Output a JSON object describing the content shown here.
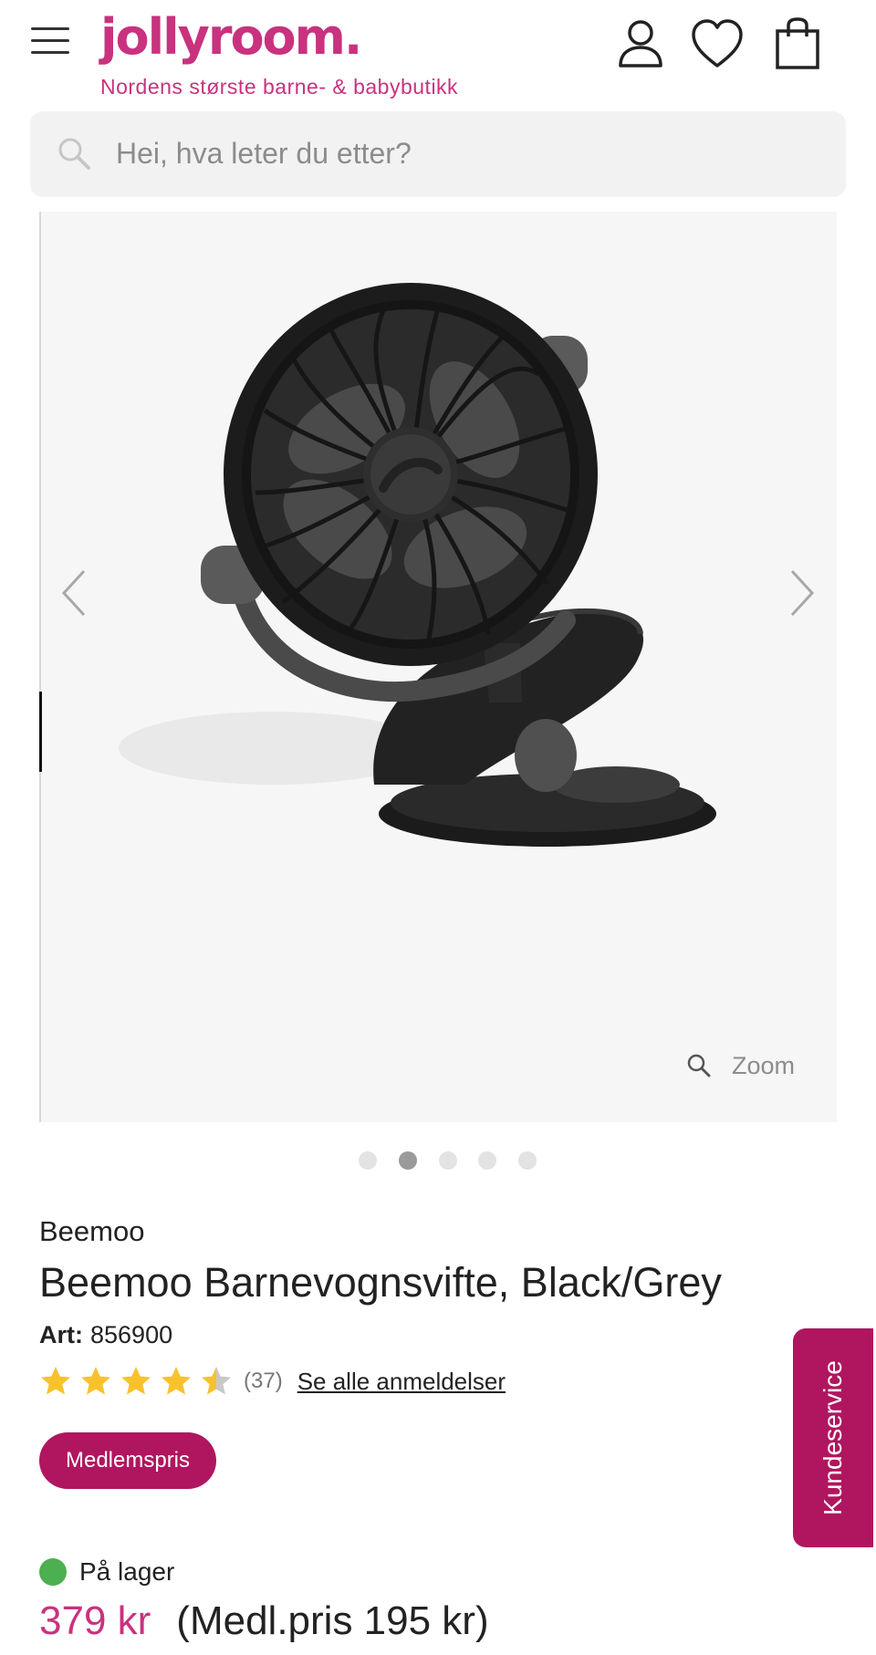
{
  "header": {
    "logo": "jollyroom.",
    "tagline": "Nordens største barne- & babybutikk",
    "icons": [
      "menu-icon",
      "user-icon",
      "heart-icon",
      "bag-icon"
    ]
  },
  "search": {
    "placeholder": "Hei, hva leter du etter?"
  },
  "gallery": {
    "zoom_label": "Zoom",
    "total_images": 5,
    "active_index": 2
  },
  "product": {
    "brand": "Beemoo",
    "title": "Beemoo Barnevognsvifte, Black/Grey",
    "art_label": "Art:",
    "art_number": "856900",
    "rating": 4.5,
    "review_count": "(37)",
    "reviews_link": "Se alle anmeldelser",
    "member_badge": "Medlemspris",
    "stock_status": "På lager",
    "price": "379 kr",
    "member_price": "(Medl.pris 195 kr)"
  },
  "customer_service": {
    "label": "Kundeservice"
  },
  "colors": {
    "brand_pink": "#c8327e",
    "badge_magenta": "#b0165f",
    "star_yellow": "#f7c22d",
    "stock_green": "#4caf50"
  }
}
